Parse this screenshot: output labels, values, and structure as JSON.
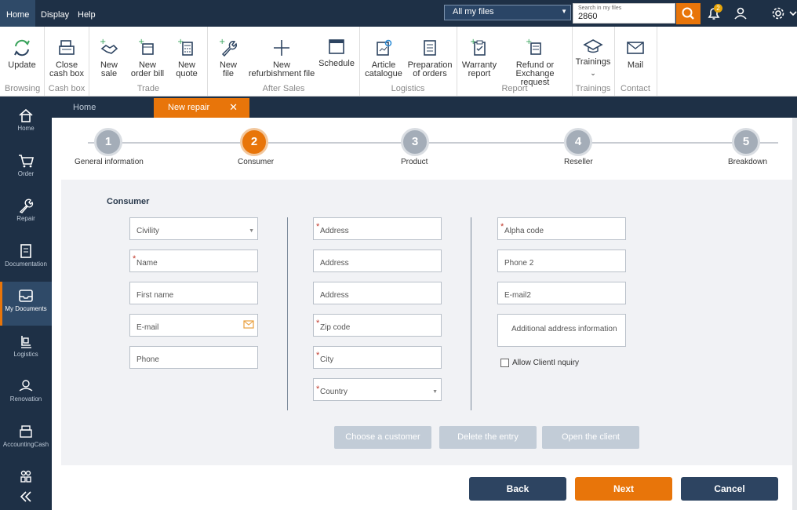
{
  "menu": {
    "home": "Home",
    "display": "Display",
    "help": "Help"
  },
  "search": {
    "scope": "All my files",
    "hint": "Search in my files",
    "value": "2860"
  },
  "notifications": {
    "count": "2"
  },
  "ribbon": {
    "update": "Update",
    "close_cash_1": "Close",
    "close_cash_2": "cash box",
    "new_sale_1": "New",
    "new_sale_2": "sale",
    "new_order_1": "New",
    "new_order_2": "order bill",
    "new_quote_1": "New",
    "new_quote_2": "quote",
    "new_file_1": "New",
    "new_file_2": "file",
    "new_refurb_1": "New",
    "new_refurb_2": "refurbishment file",
    "schedule": "Schedule",
    "article_1": "Article",
    "article_2": "catalogue",
    "prep_1": "Preparation",
    "prep_2": "of orders",
    "warranty_1": "Warranty",
    "warranty_2": "report",
    "refund_1": "Refund or",
    "refund_2": "Exchange request",
    "trainings": "Trainings",
    "mail": "Mail",
    "groups": {
      "browsing": "Browsing",
      "cash": "Cash box",
      "trade": "Trade",
      "after_sales": "After Sales",
      "logistics": "Logistics",
      "report": "Report",
      "trainings": "Trainings",
      "contact": "Contact"
    }
  },
  "nav": {
    "home": "Home",
    "order": "Order",
    "repair": "Repair",
    "documentation": "Documentation",
    "my_documents": "My Documents",
    "logistics": "Logistics",
    "renovation": "Renovation",
    "accounting": "AccountingCash"
  },
  "tabs": {
    "home": "Home",
    "active": "New repair"
  },
  "steps": [
    {
      "num": "1",
      "label": "General information"
    },
    {
      "num": "2",
      "label": "Consumer"
    },
    {
      "num": "3",
      "label": "Product"
    },
    {
      "num": "4",
      "label": "Reseller"
    },
    {
      "num": "5",
      "label": "Breakdown"
    }
  ],
  "form": {
    "title": "Consumer",
    "civility": "Civility",
    "name": "Name",
    "first_name": "First name",
    "email": "E-mail",
    "phone": "Phone",
    "address1": "Address",
    "address2": "Address",
    "address3": "Address",
    "zip": "Zip code",
    "city": "City",
    "country": "Country",
    "alpha": "Alpha code",
    "phone2": "Phone 2",
    "email2": "E-mail2",
    "additional": "Additional address information",
    "allow": "Allow ClientI nquiry"
  },
  "actions": {
    "choose": "Choose a customer",
    "delete": "Delete the entry",
    "open": "Open the client"
  },
  "footer": {
    "back": "Back",
    "next": "Next",
    "cancel": "Cancel"
  },
  "colors": {
    "accent": "#e8750a",
    "navy": "#1e3046",
    "button_dark": "#2d4461",
    "disabled": "#c2ccd7"
  }
}
